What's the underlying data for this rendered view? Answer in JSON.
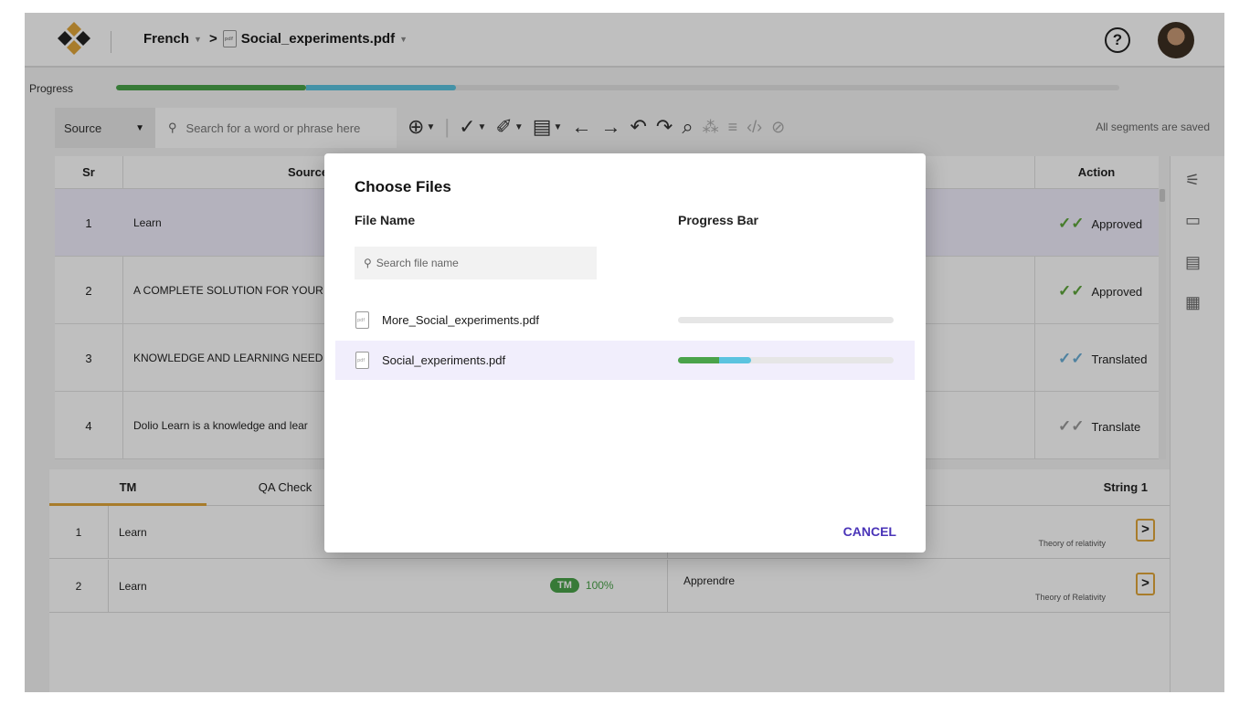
{
  "header": {
    "language": "French",
    "file": "Social_experiments.pdf",
    "icons": {
      "logo": "puzzle-logo",
      "help": "?",
      "avatar": "user-avatar"
    }
  },
  "progress": {
    "label": "Progress",
    "green_fraction": 0.189,
    "blue_fraction": 0.15,
    "colors": {
      "green": "#4aa34a",
      "blue": "#5bc3df"
    }
  },
  "toolbar": {
    "source_select": "Source",
    "search_placeholder": "Search for a word or phrase here",
    "status": "All segments are saved"
  },
  "grid": {
    "columns": {
      "sr": "Sr",
      "source": "Source",
      "action": "Action"
    },
    "rows": [
      {
        "sr": "1",
        "source": "Learn",
        "action": "Approved",
        "tick_color": "#5ea63b"
      },
      {
        "sr": "2",
        "source": "A COMPLETE SOLUTION FOR YOUR",
        "action": "Approved",
        "tick_color": "#5ea63b"
      },
      {
        "sr": "3",
        "source": "KNOWLEDGE AND LEARNING NEED",
        "action": "Translated",
        "tick_color": "#6aaed6"
      },
      {
        "sr": "4",
        "source": "Dolio Learn is a knowledge and lear",
        "action": "Translate",
        "tick_color": "#9a9a9a"
      }
    ]
  },
  "bottom": {
    "tabs": [
      "TM",
      "QA Check"
    ],
    "string_label": "String 1",
    "rows": [
      {
        "num": "1",
        "source": "Learn",
        "target": "",
        "note": "Theory of relativity"
      },
      {
        "num": "2",
        "source": "Learn",
        "tm_badge": "TM",
        "tm_pct": "100%",
        "target": "Apprendre",
        "note": "Theory of Relativity"
      }
    ]
  },
  "modal": {
    "title": "Choose Files",
    "col_file": "File Name",
    "col_progress": "Progress Bar",
    "search_placeholder": "Search file name",
    "files": [
      {
        "name": "More_Social_experiments.pdf",
        "green": 0,
        "blue": 0
      },
      {
        "name": "Social_experiments.pdf",
        "green": 0.19,
        "blue": 0.15
      }
    ],
    "cancel": "CANCEL",
    "accent": "#4a34b8"
  }
}
